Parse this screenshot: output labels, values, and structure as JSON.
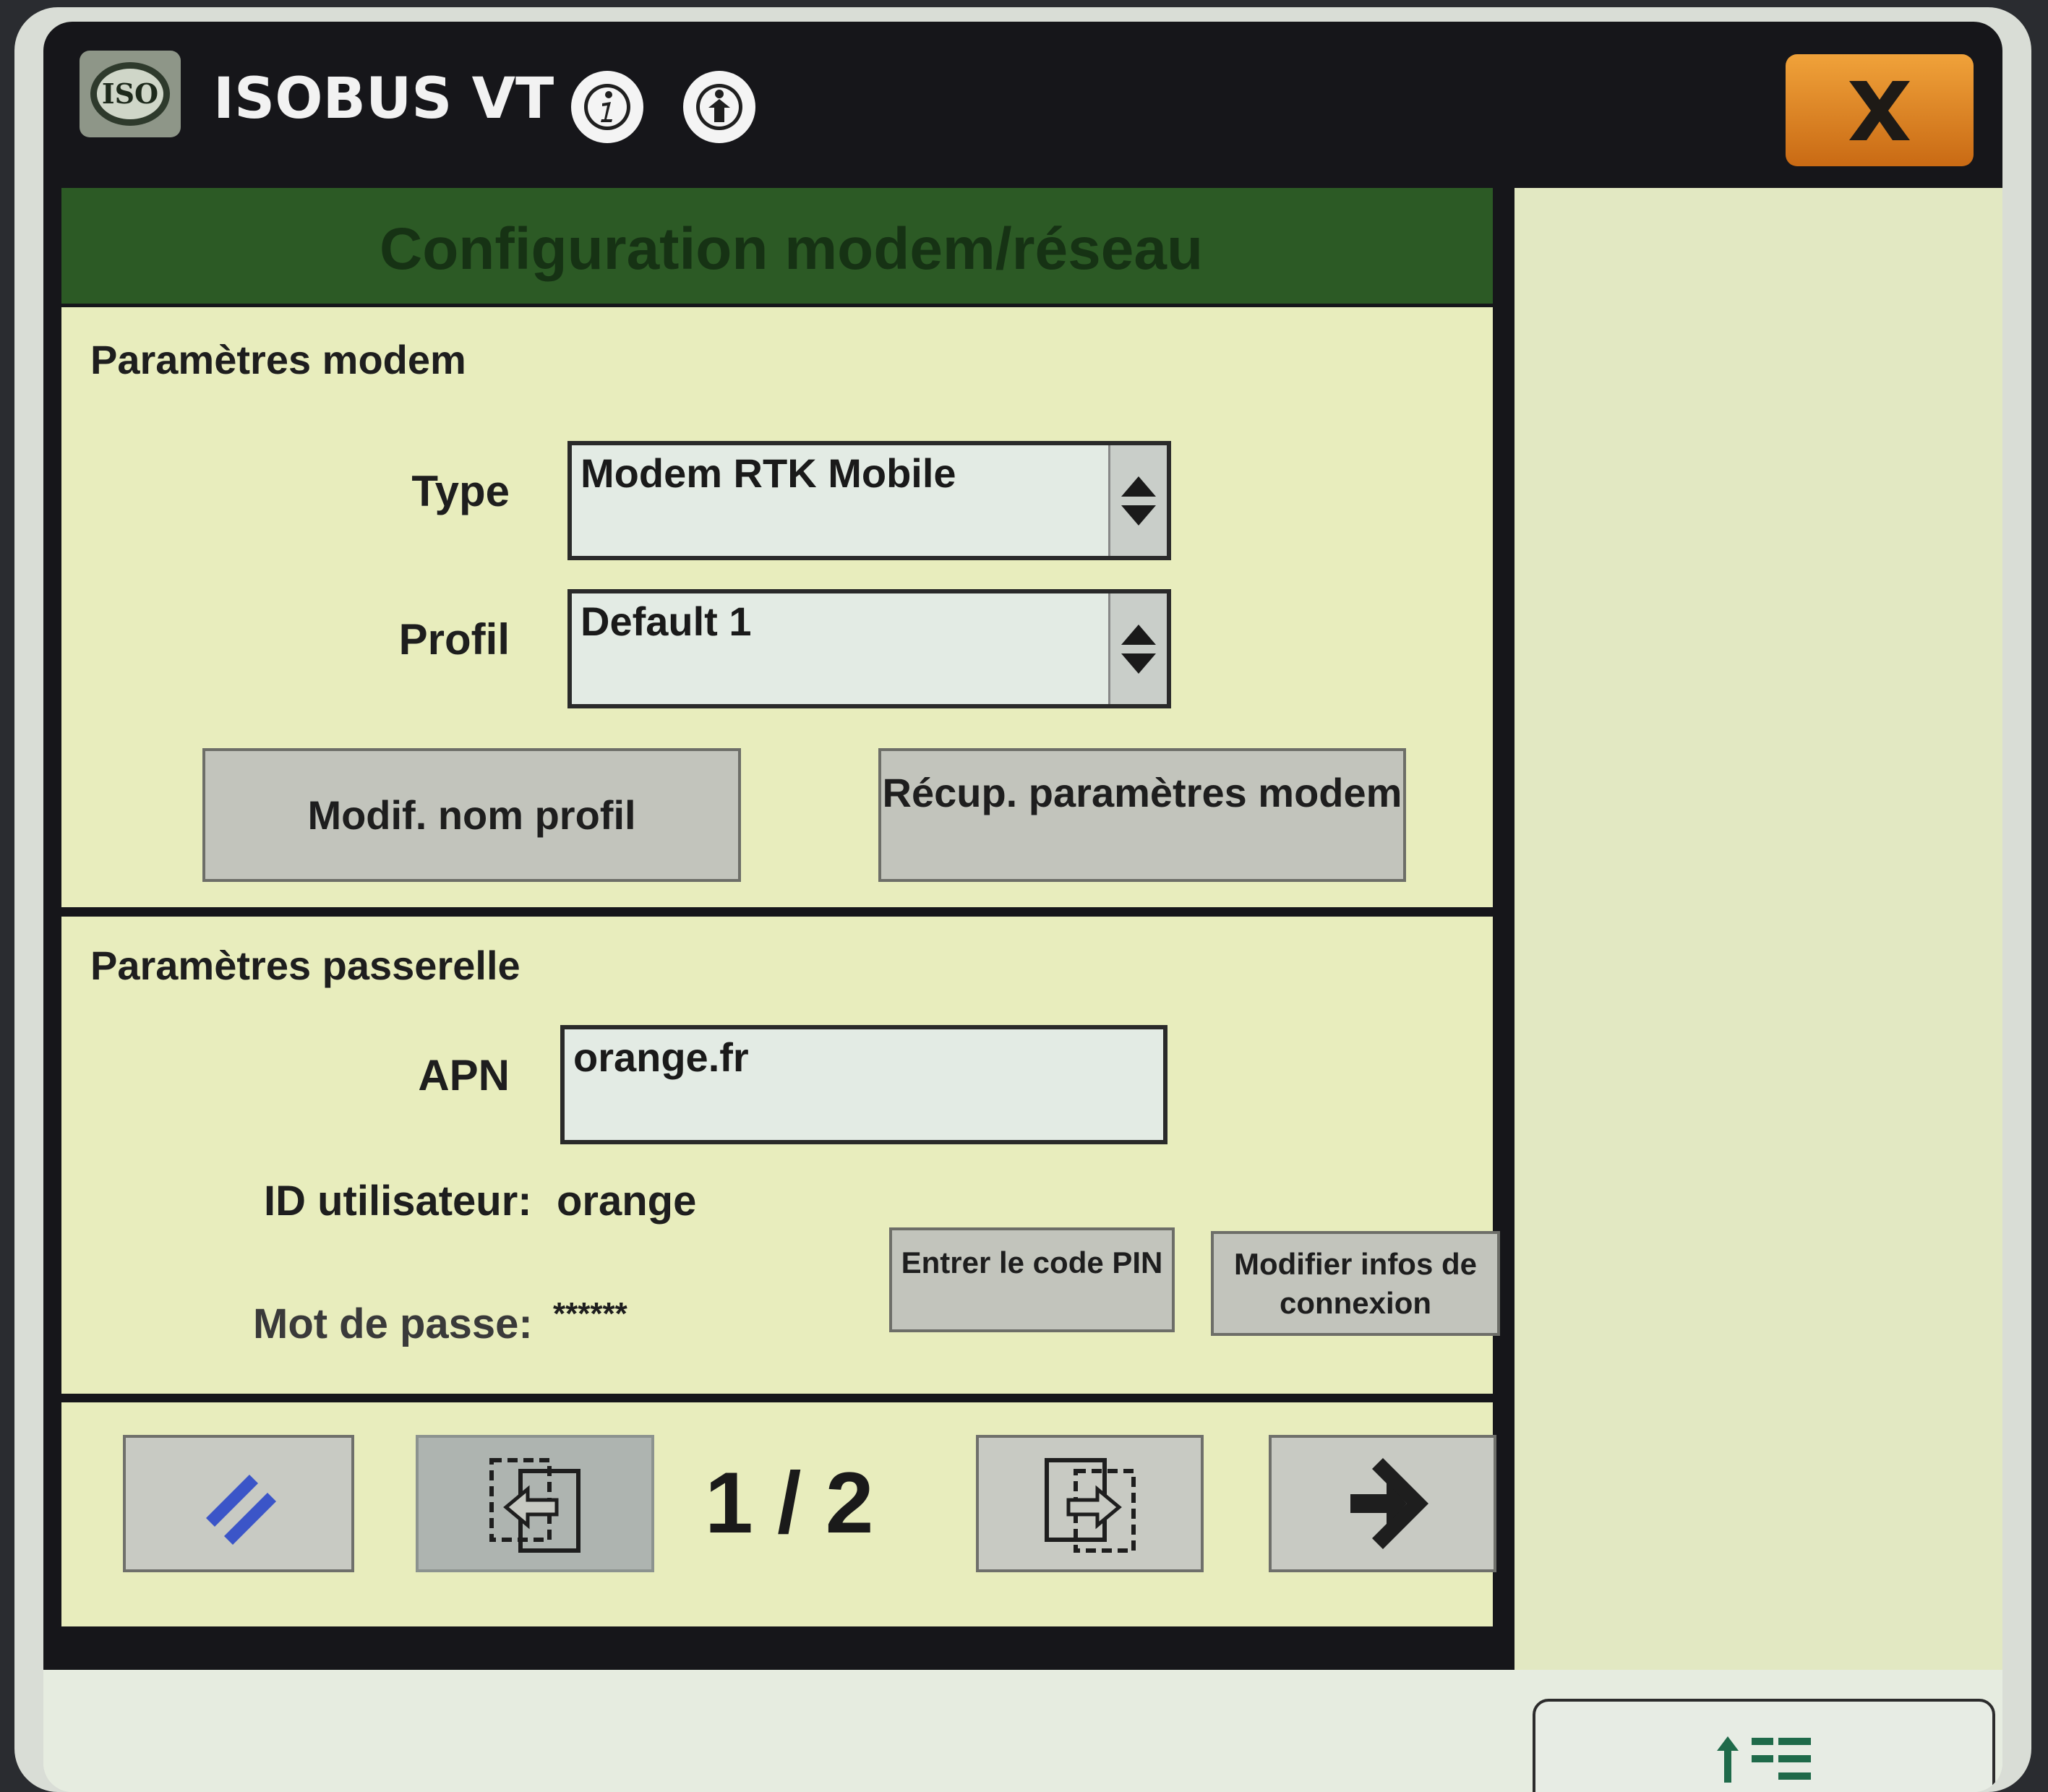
{
  "header": {
    "logo_text": "ISO",
    "app_title": "ISOBUS VT",
    "icons": [
      "info-icon",
      "person-info-icon"
    ],
    "close_icon": "close-icon"
  },
  "dialog": {
    "title": "Configuration modem/réseau",
    "modem_section": {
      "heading": "Paramètres modem",
      "type_label": "Type",
      "type_value": "Modem RTK Mobile",
      "profile_label": "Profil",
      "profile_value": "Default 1",
      "rename_button": "Modif. nom profil",
      "fetch_button": "Récup. paramètres modem"
    },
    "gateway_section": {
      "heading": "Paramètres passerelle",
      "apn_label": "APN",
      "apn_value": "orange.fr",
      "user_id_label": "ID utilisateur:",
      "user_id_value": "orange",
      "password_label": "Mot de passe:",
      "password_value": "******",
      "pin_button": "Entrer le code PIN",
      "edit_connection_button": "Modifier infos de connexion"
    },
    "navigation": {
      "page_indicator": "1 / 2",
      "icons": [
        "cancel-icon",
        "page-back-icon",
        "page-forward-icon",
        "enter-icon"
      ]
    }
  },
  "bottom_bar": {
    "softkey_icon": "upload-list-icon"
  },
  "colors": {
    "titlebar": "#16161a",
    "dialog_header": "#2c5a25",
    "panel_background": "#e8edbd",
    "close_button": "#e08a2a",
    "cancel_icon": "#3b55c8"
  }
}
